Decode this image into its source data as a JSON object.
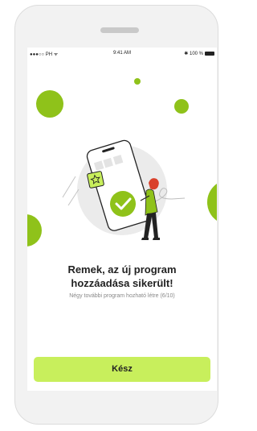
{
  "status_bar": {
    "carrier": "●●●○○ PH ᯤ",
    "time": "9:41 AM",
    "battery": "✱ 100 %"
  },
  "message": {
    "line1": "Remek, az új program",
    "line2": "hozzáadása sikerült!",
    "subtext": "Négy további program hozható létre (6/10)"
  },
  "actions": {
    "done_label": "Kész"
  },
  "colors": {
    "accent": "#8fc21a",
    "button": "#c8ef5c",
    "background": "#f2f2f2"
  },
  "icons": [
    "star-icon",
    "checkmark-icon"
  ]
}
